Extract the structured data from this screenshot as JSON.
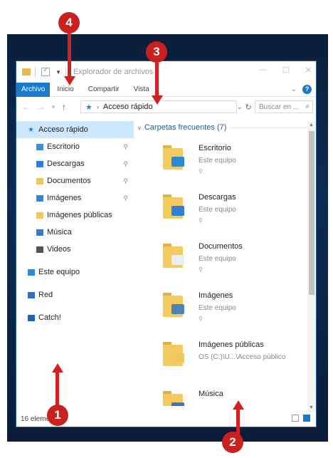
{
  "window": {
    "title": "Explorador de archivos",
    "tabs": [
      "Archivo",
      "Inicio",
      "Compartir",
      "Vista"
    ],
    "address": "Acceso rápido",
    "search_placeholder": "Buscar en ...",
    "status": "16 elementos"
  },
  "nav": {
    "items": [
      {
        "label": "Acceso rápido",
        "icon": "star-icon",
        "color": "#2a7fd6",
        "indent": 0,
        "pinned": false,
        "selected": true
      },
      {
        "label": "Escritorio",
        "icon": "desktop-folder-icon",
        "color": "#3b8fd6",
        "indent": 1,
        "pinned": true,
        "selected": false
      },
      {
        "label": "Descargas",
        "icon": "downloads-folder-icon",
        "color": "#2f7ed8",
        "indent": 1,
        "pinned": true,
        "selected": false
      },
      {
        "label": "Documentos",
        "icon": "documents-folder-icon",
        "color": "#e8c46a",
        "indent": 1,
        "pinned": true,
        "selected": false
      },
      {
        "label": "Imágenes",
        "icon": "pictures-folder-icon",
        "color": "#3b86c8",
        "indent": 1,
        "pinned": true,
        "selected": false
      },
      {
        "label": "Imágenes públicas",
        "icon": "folder-icon",
        "color": "#f0c75e",
        "indent": 1,
        "pinned": false,
        "selected": false
      },
      {
        "label": "Música",
        "icon": "music-folder-icon",
        "color": "#3a78c0",
        "indent": 1,
        "pinned": false,
        "selected": false
      },
      {
        "label": "Videos",
        "icon": "videos-folder-icon",
        "color": "#555555",
        "indent": 1,
        "pinned": false,
        "selected": false
      },
      {
        "label": "Este equipo",
        "icon": "computer-icon",
        "color": "#2a8bdc",
        "indent": 0,
        "pinned": false,
        "selected": false
      },
      {
        "label": "Red",
        "icon": "network-icon",
        "color": "#2a6fc8",
        "indent": 0,
        "pinned": false,
        "selected": false
      },
      {
        "label": "Catch!",
        "icon": "catch-icon",
        "color": "#1e63b5",
        "indent": 0,
        "pinned": false,
        "selected": false
      }
    ]
  },
  "content": {
    "group_title": "Carpetas frecuentes (7)",
    "tiles": [
      {
        "name": "Escritorio",
        "location": "Este equipo",
        "pinned": true,
        "overlay_color": "#2a8ad8"
      },
      {
        "name": "Descargas",
        "location": "Este equipo",
        "pinned": true,
        "overlay_color": "#2f7ed8"
      },
      {
        "name": "Documentos",
        "location": "Este equipo",
        "pinned": true,
        "overlay_color": "#e9eef5"
      },
      {
        "name": "Imágenes",
        "location": "Este equipo",
        "pinned": true,
        "overlay_color": "#4a83b8"
      },
      {
        "name": "Imágenes públicas",
        "location": "OS (C:)\\U...\\Acceso público",
        "pinned": false,
        "overlay_color": "#f0c75e"
      },
      {
        "name": "Música",
        "location": "",
        "pinned": false,
        "overlay_color": "#3a78c0"
      }
    ]
  },
  "callouts": [
    "1",
    "2",
    "3",
    "4"
  ],
  "colors": {
    "accent": "#1979ca",
    "callout": "#c8211f",
    "selection": "#cce8ff",
    "folder": "#f4c95d",
    "desktop": "#0e2a52"
  }
}
